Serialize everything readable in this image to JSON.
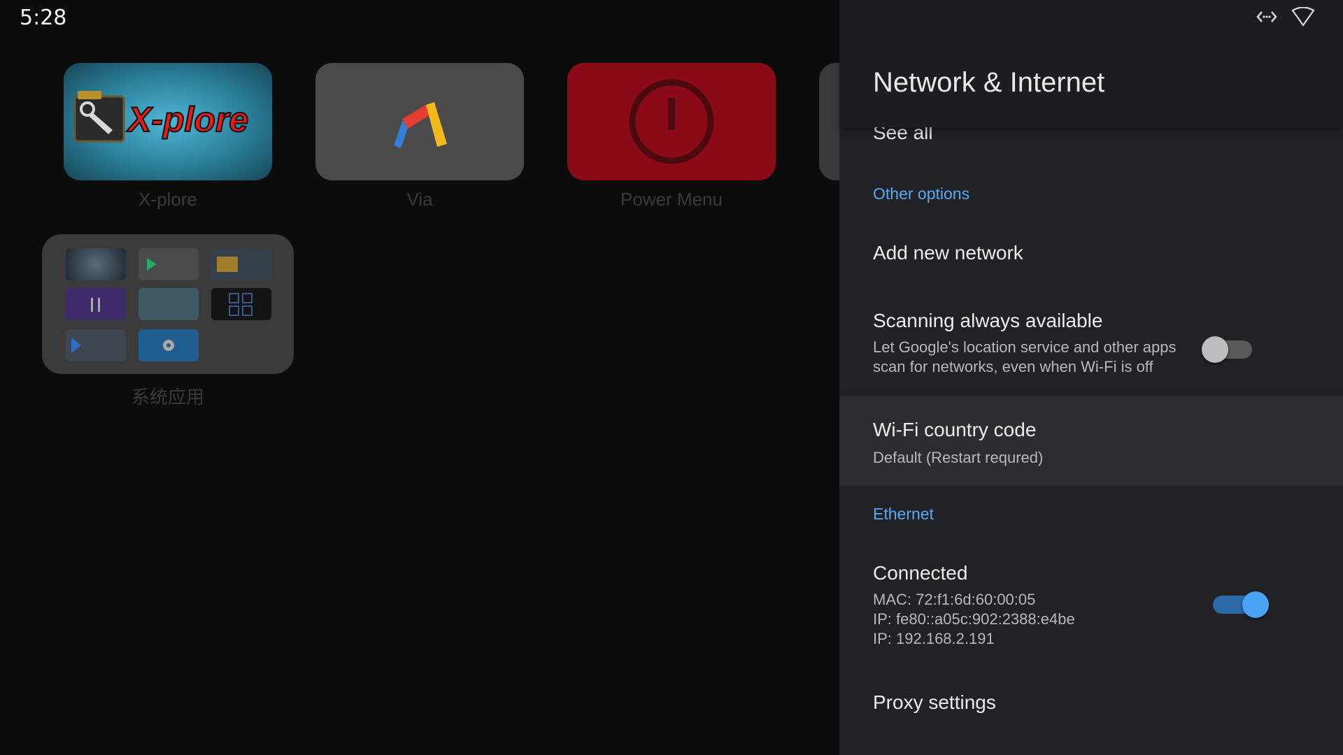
{
  "status_bar": {
    "time": "5:28"
  },
  "launcher": {
    "apps": [
      {
        "label": "X-plore",
        "logo_text": "X-plore"
      },
      {
        "label": "Via"
      },
      {
        "label": "Power Menu"
      }
    ],
    "folder": {
      "label": "系统应用"
    }
  },
  "settings": {
    "title": "Network & Internet",
    "see_all": "See all",
    "other_options_header": "Other options",
    "add_network": "Add new network",
    "scanning": {
      "title": "Scanning always available",
      "desc_line1": "Let Google's location service and other apps",
      "desc_line2": "scan for networks, even when Wi-Fi is off",
      "enabled": false
    },
    "country_code": {
      "title": "Wi-Fi country code",
      "value": "Default (Restart requred)"
    },
    "ethernet_header": "Ethernet",
    "ethernet": {
      "title": "Connected",
      "mac": "MAC: 72:f1:6d:60:00:05",
      "ipv6": "IP: fe80::a05c:902:2388:e4be",
      "ipv4": "IP: 192.168.2.191",
      "enabled": true
    },
    "proxy": "Proxy settings"
  },
  "colors": {
    "accent": "#5aa9f2",
    "toggle_on_knob": "#4aa3f5",
    "toggle_on_track": "#2f6aa8",
    "toggle_off_knob": "#bdbdbd",
    "toggle_off_track": "#5a5a5a"
  }
}
